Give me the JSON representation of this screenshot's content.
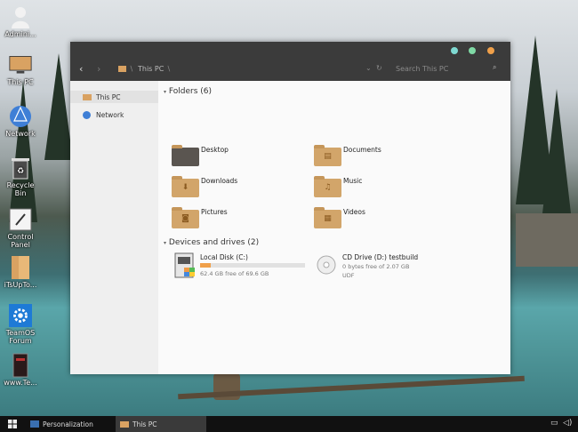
{
  "desktop_icons": [
    {
      "label": "Admini...",
      "icon": "user-icon"
    },
    {
      "label": "This PC",
      "icon": "computer-icon"
    },
    {
      "label": "Network",
      "icon": "network-icon"
    },
    {
      "label": "Recycle Bin",
      "icon": "recycle-bin-icon"
    },
    {
      "label": "Control Panel",
      "icon": "control-panel-icon"
    },
    {
      "label": "iTsUpTo...",
      "icon": "document-icon"
    },
    {
      "label": "TeamOS Forum",
      "icon": "gear-icon"
    },
    {
      "label": "www.Te...",
      "icon": "book-icon"
    }
  ],
  "window": {
    "title_dots": [
      "#7fd9d2",
      "#7fd9a5",
      "#f0a04a"
    ],
    "breadcrumb": "This PC",
    "search_placeholder": "Search This PC",
    "nav_items": [
      {
        "label": "This PC",
        "icon": "computer-icon",
        "selected": true
      },
      {
        "label": "Network",
        "icon": "network-icon",
        "selected": false
      }
    ],
    "folders_header": "Folders (6)",
    "folders": [
      {
        "label": "Desktop",
        "icon": "desktop-folder-icon"
      },
      {
        "label": "Documents",
        "icon": "documents-folder-icon"
      },
      {
        "label": "Downloads",
        "icon": "downloads-folder-icon"
      },
      {
        "label": "Music",
        "icon": "music-folder-icon"
      },
      {
        "label": "Pictures",
        "icon": "pictures-folder-icon"
      },
      {
        "label": "Videos",
        "icon": "videos-folder-icon"
      }
    ],
    "drives_header": "Devices and drives (2)",
    "drives": [
      {
        "label": "Local Disk (C:)",
        "free": "62.4 GB free of 69.6 GB",
        "used_fraction": 0.1,
        "icon": "hard-drive-icon"
      },
      {
        "label": "CD Drive (D:) testbuild",
        "free": "0 bytes free of 2.07 GB",
        "fs": "UDF",
        "icon": "cd-drive-icon"
      }
    ]
  },
  "taskbar": {
    "items": [
      {
        "label": "Personalization"
      },
      {
        "label": "This PC"
      }
    ]
  },
  "colors": {
    "accent": "#f0a04a",
    "titlebar": "#3b3b3b"
  }
}
